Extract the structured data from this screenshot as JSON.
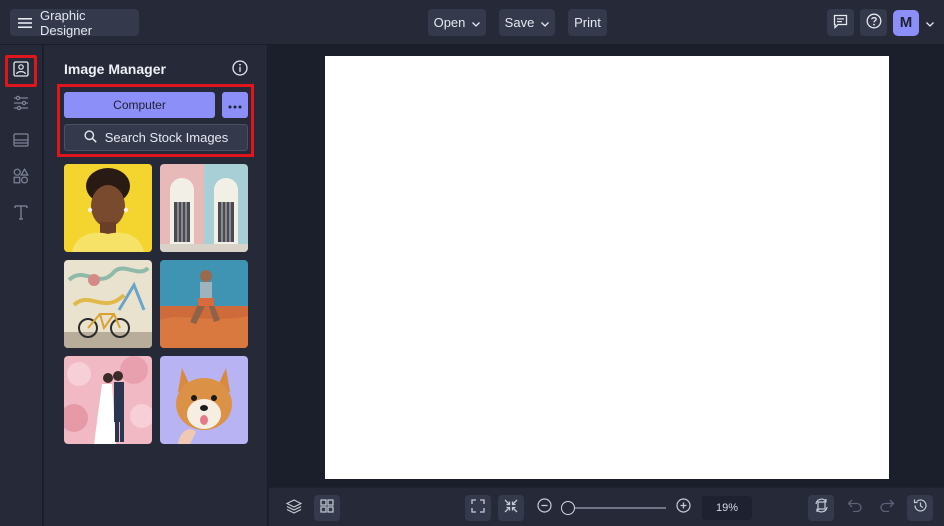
{
  "header": {
    "app_title": "Graphic Designer",
    "open_label": "Open",
    "save_label": "Save",
    "print_label": "Print",
    "avatar_initial": "M",
    "icons": [
      "menu-icon",
      "chevron-down-icon",
      "comment-icon",
      "help-icon"
    ]
  },
  "rail": {
    "items": [
      "image-icon",
      "adjust-icon",
      "layout-icon",
      "shapes-icon",
      "text-icon"
    ],
    "active": "image-icon"
  },
  "panel": {
    "title": "Image Manager",
    "computer_label": "Computer",
    "search_label": "Search Stock Images",
    "thumbnails": [
      "portrait-woman-yellow",
      "pastel-doors",
      "graffiti-bicycle",
      "man-on-sand",
      "couple-blossoms",
      "shiba-dog"
    ]
  },
  "bottom": {
    "zoom_text": "19%",
    "zoom_fraction": 0.0,
    "icons": [
      "layers-icon",
      "grid-icon",
      "fit-screen-icon",
      "shrink-icon",
      "zoom-out-icon",
      "zoom-in-icon",
      "rotate-icon",
      "undo-icon",
      "redo-icon",
      "history-icon"
    ]
  },
  "colors": {
    "accent": "#8b8ff7",
    "highlight": "#e0161e",
    "background": "#1e2130",
    "panel": "#262a38"
  }
}
